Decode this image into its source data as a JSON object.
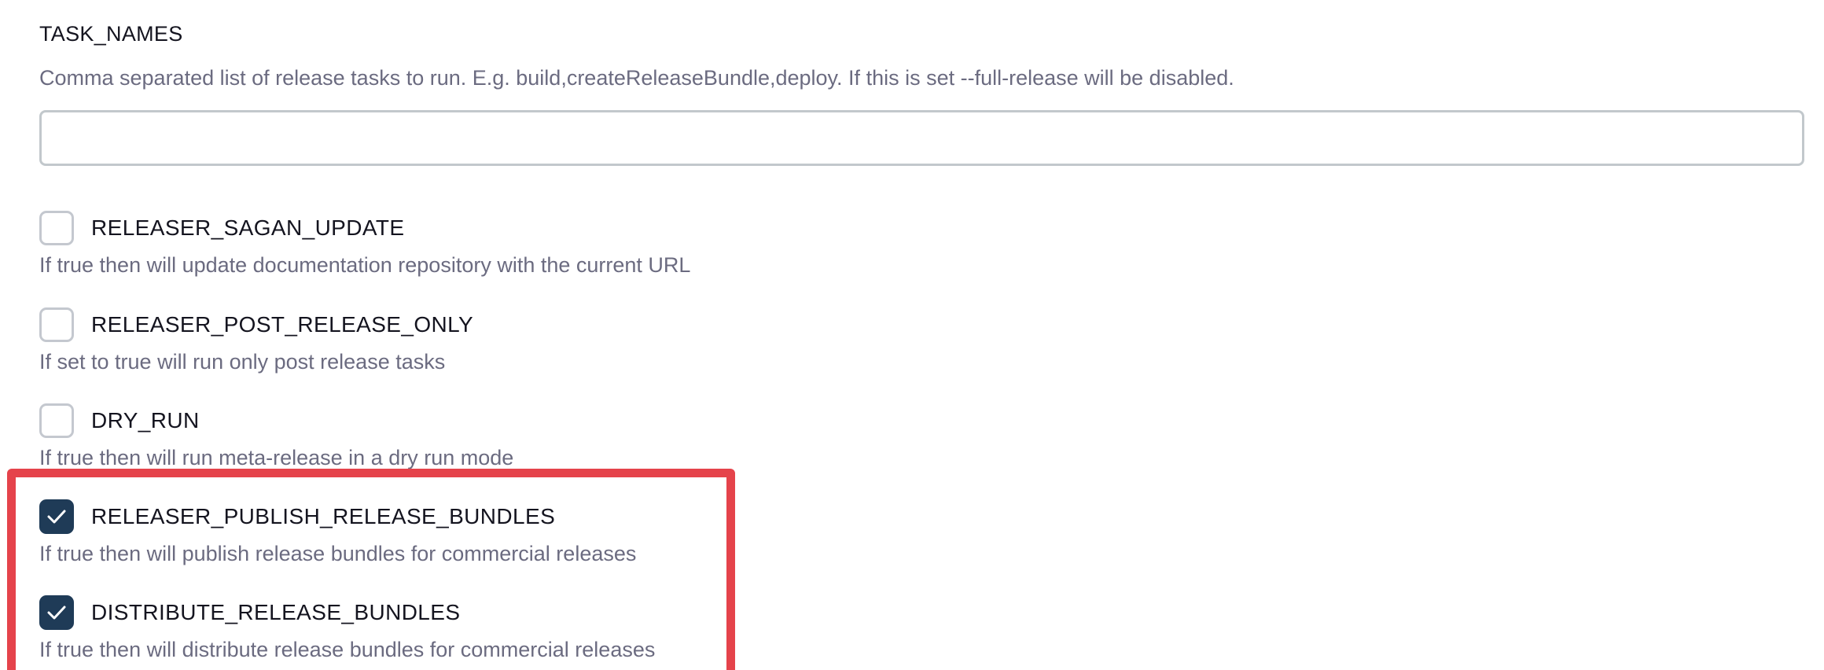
{
  "task_names": {
    "title": "TASK_NAMES",
    "description": "Comma separated list of release tasks to run. E.g. build,createReleaseBundle,deploy.  If this is set --full-release will be disabled.",
    "value": "",
    "placeholder": ""
  },
  "params": [
    {
      "name": "RELEASER_SAGAN_UPDATE",
      "description": "If true then will update documentation repository with the current URL",
      "checked": false
    },
    {
      "name": "RELEASER_POST_RELEASE_ONLY",
      "description": "If set to true will run only post release tasks",
      "checked": false
    },
    {
      "name": "DRY_RUN",
      "description": "If true then will run meta-release in a dry run mode",
      "checked": false
    },
    {
      "name": "RELEASER_PUBLISH_RELEASE_BUNDLES",
      "description": "If true then will publish release bundles for commercial releases",
      "checked": true
    },
    {
      "name": "DISTRIBUTE_RELEASE_BUNDLES",
      "description": "If true then will distribute release bundles for commercial releases",
      "checked": true
    }
  ],
  "colors": {
    "checkbox_checked": "#1f3b57",
    "highlight": "#e5434b",
    "description_text": "#6b6b80"
  }
}
